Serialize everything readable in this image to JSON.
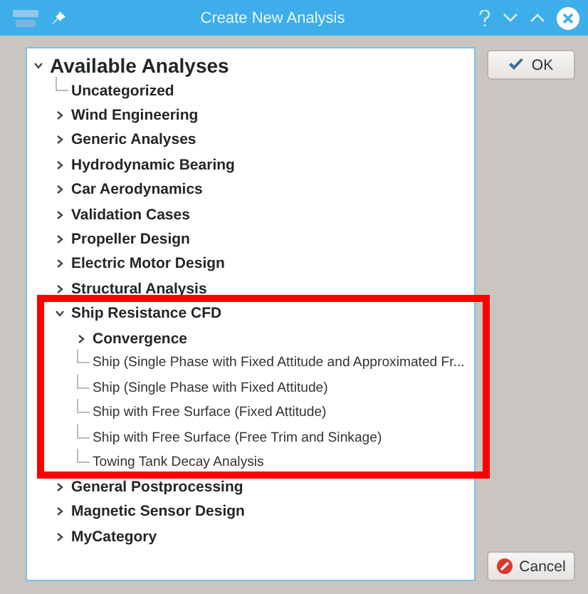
{
  "window": {
    "title": "Create New Analysis"
  },
  "tree": {
    "label": "Available Analyses",
    "expanded": true,
    "children": [
      {
        "label": "Uncategorized",
        "kind": "category"
      },
      {
        "label": "Wind Engineering",
        "kind": "category",
        "expanded": false
      },
      {
        "label": "Generic Analyses",
        "kind": "category",
        "expanded": false
      },
      {
        "label": "Hydrodynamic Bearing",
        "kind": "category",
        "expanded": false
      },
      {
        "label": "Car Aerodynamics",
        "kind": "category",
        "expanded": false
      },
      {
        "label": "Validation Cases",
        "kind": "category",
        "expanded": false
      },
      {
        "label": "Propeller Design",
        "kind": "category",
        "expanded": false
      },
      {
        "label": "Electric Motor Design",
        "kind": "category",
        "expanded": false
      },
      {
        "label": "Structural Analysis",
        "kind": "category",
        "expanded": false
      },
      {
        "label": "Ship Resistance CFD",
        "kind": "category",
        "expanded": true,
        "children": [
          {
            "label": "Convergence",
            "kind": "category",
            "expanded": false
          },
          {
            "label": "Ship (Single Phase with Fixed Attitude and Approximated Fr...",
            "kind": "analysis"
          },
          {
            "label": "Ship (Single Phase with Fixed Attitude)",
            "kind": "analysis"
          },
          {
            "label": "Ship with Free Surface (Fixed Attitude)",
            "kind": "analysis"
          },
          {
            "label": "Ship with Free Surface (Free Trim and Sinkage)",
            "kind": "analysis"
          },
          {
            "label": "Towing Tank Decay Analysis",
            "kind": "analysis"
          }
        ]
      },
      {
        "label": "General Postprocessing",
        "kind": "category",
        "expanded": false
      },
      {
        "label": "Magnetic Sensor Design",
        "kind": "category",
        "expanded": false
      },
      {
        "label": "MyCategory",
        "kind": "category",
        "expanded": false
      }
    ]
  },
  "buttons": [
    {
      "label": "OK",
      "kind": "ok"
    },
    {
      "label": "Cancel",
      "kind": "cancel"
    }
  ]
}
